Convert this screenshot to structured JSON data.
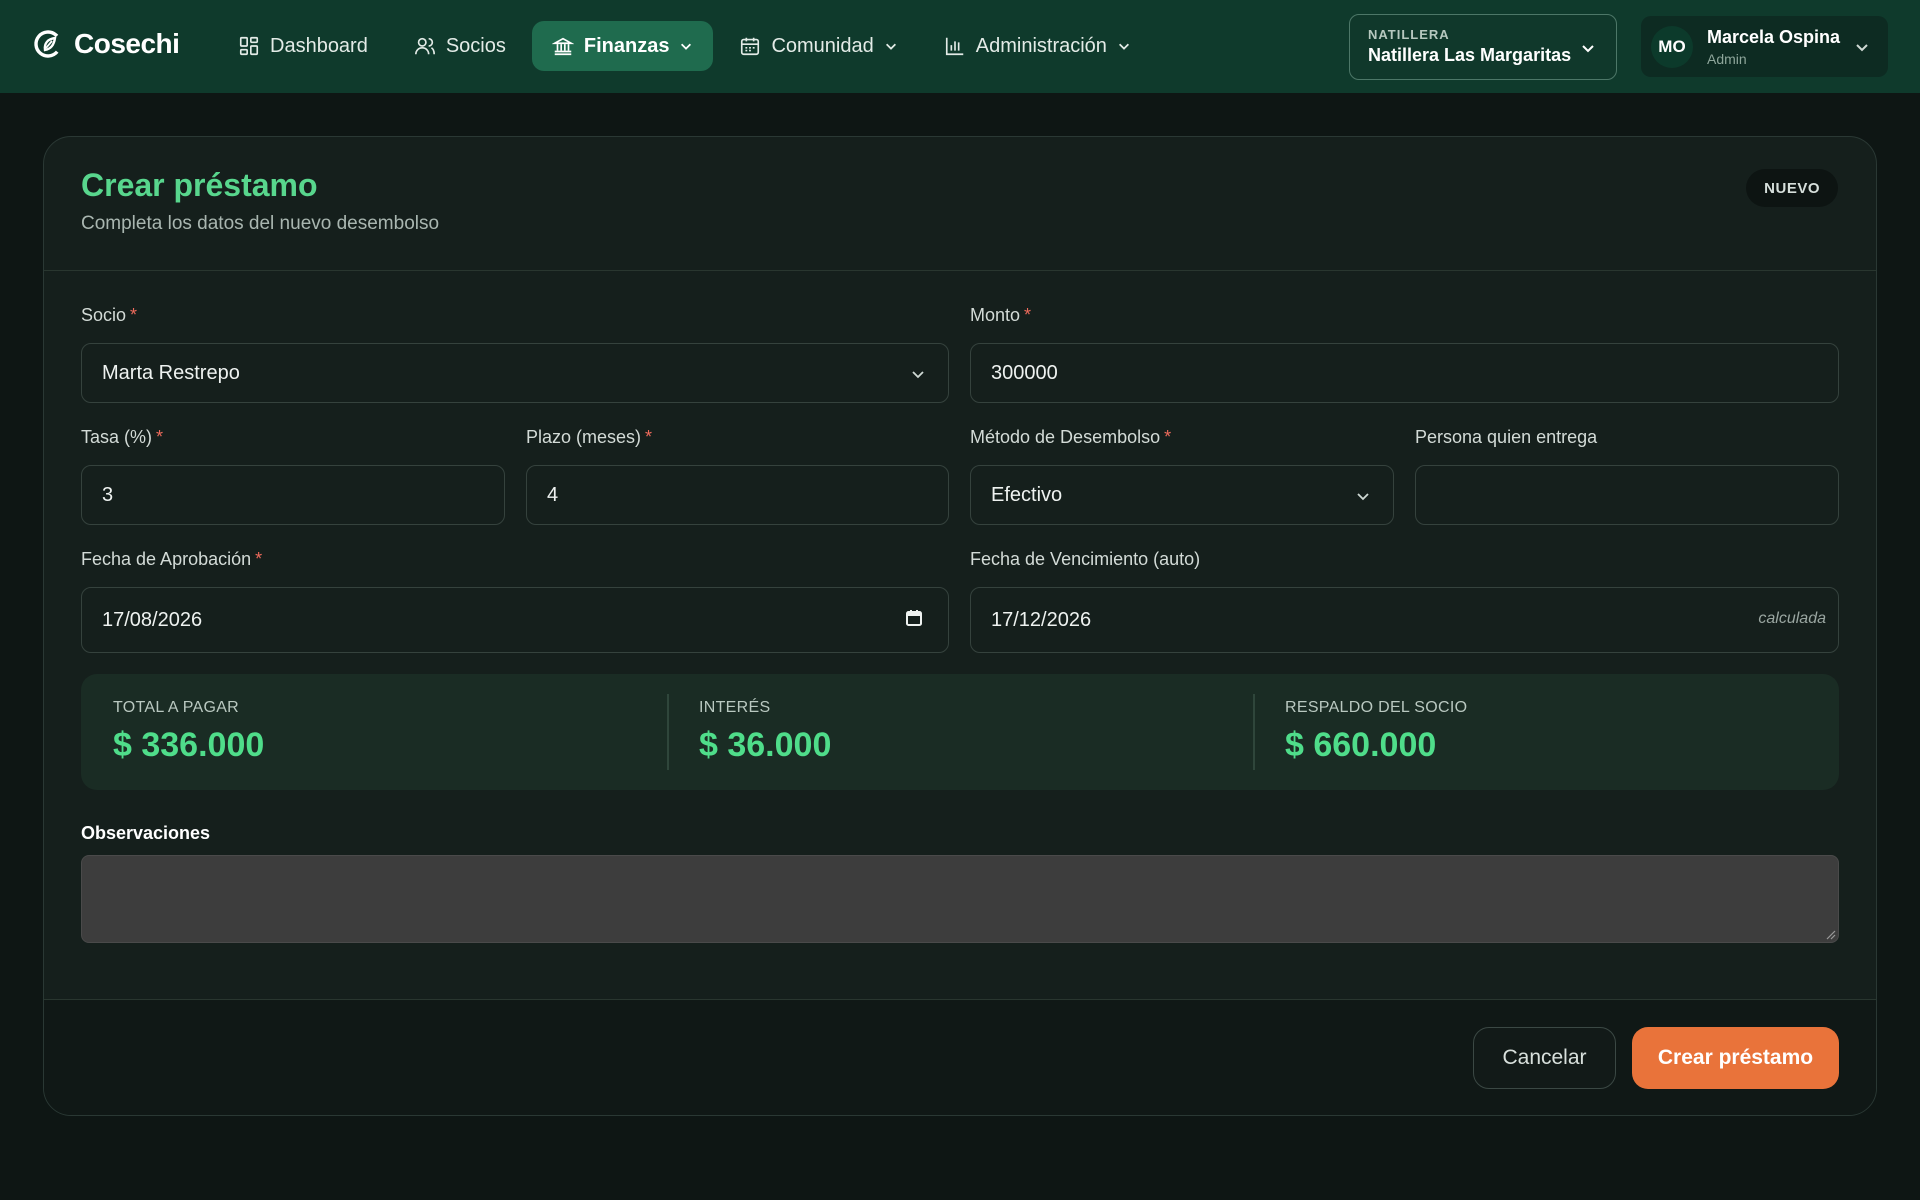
{
  "brand": {
    "name": "Cosechi",
    "logo_icon": "leaf-c-logo-icon"
  },
  "nav": {
    "items": [
      {
        "label": "Dashboard",
        "icon": "grid-icon"
      },
      {
        "label": "Socios",
        "icon": "users-icon"
      },
      {
        "label": "Finanzas",
        "icon": "bank-icon",
        "active": true
      },
      {
        "label": "Comunidad",
        "icon": "calendar-icon"
      },
      {
        "label": "Administración",
        "icon": "bar-chart-icon"
      }
    ]
  },
  "org": {
    "caption": "NATILLERA",
    "name": "Natillera Las Margaritas"
  },
  "user": {
    "initials": "MO",
    "name": "Marcela Ospina",
    "role": "Admin"
  },
  "card": {
    "title": "Crear préstamo",
    "subtitle": "Completa los datos del nuevo desembolso",
    "badge": "NUEVO"
  },
  "form": {
    "required_mark": "*",
    "socio": {
      "label": "Socio",
      "value": "Marta Restrepo"
    },
    "monto": {
      "label": "Monto",
      "value": "300000"
    },
    "tasa": {
      "label": "Tasa (%)",
      "value": "3"
    },
    "plazo": {
      "label": "Plazo (meses)",
      "value": "4"
    },
    "metodo": {
      "label": "Método de Desembolso",
      "value": "Efectivo"
    },
    "persona": {
      "label": "Persona quien entrega",
      "value": ""
    },
    "fecha_aprobacion": {
      "label": "Fecha de Aprobación",
      "value": "17/08/2026"
    },
    "fecha_vencimiento": {
      "label": "Fecha de Vencimiento (auto)",
      "value": "17/12/2026",
      "hint": "calculada"
    },
    "observaciones": {
      "label": "Observaciones",
      "value": ""
    }
  },
  "summary": {
    "total": {
      "caption": "TOTAL A PAGAR",
      "value": "$ 336.000"
    },
    "interes": {
      "caption": "INTERÉS",
      "value": "$ 36.000"
    },
    "respaldo": {
      "caption": "RESPALDO DEL SOCIO",
      "value": "$ 660.000"
    }
  },
  "actions": {
    "cancel": "Cancelar",
    "submit": "Crear préstamo"
  },
  "colors": {
    "nav_bg": "#0f3a2c",
    "accent_green": "#58d68d",
    "primary_orange": "#e9733a",
    "required_red": "#ee6b5c"
  }
}
